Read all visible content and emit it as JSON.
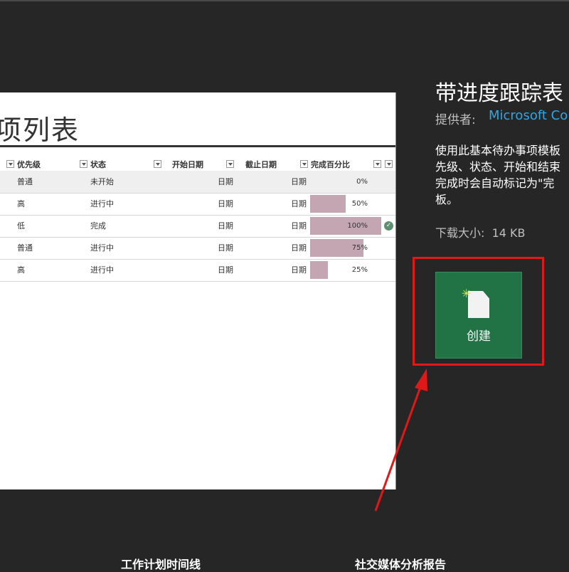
{
  "preview": {
    "title": "项列表",
    "columns": [
      "优先级",
      "状态",
      "开始日期",
      "截止日期",
      "完成百分比"
    ],
    "rows": [
      {
        "priority": "普通",
        "status": "未开始",
        "start": "日期",
        "end": "日期",
        "percent": "0%",
        "progress": 0
      },
      {
        "priority": "高",
        "status": "进行中",
        "start": "日期",
        "end": "日期",
        "percent": "50%",
        "progress": 50
      },
      {
        "priority": "低",
        "status": "完成",
        "start": "日期",
        "end": "日期",
        "percent": "100%",
        "progress": 100,
        "check_icon": "check-circle-icon",
        "check_color": "#5f8f73"
      },
      {
        "priority": "普通",
        "status": "进行中",
        "start": "日期",
        "end": "日期",
        "percent": "75%",
        "progress": 75
      },
      {
        "priority": "高",
        "status": "进行中",
        "start": "日期",
        "end": "日期",
        "percent": "25%",
        "progress": 25
      }
    ],
    "bar_color": "#c4a6b3"
  },
  "template": {
    "title": "带进度跟踪表",
    "provider_label": "提供者:",
    "provider_name": "Microsoft Co",
    "description_lines": [
      "使用此基本待办事项模板",
      "先级、状态、开始和结束",
      "完成时会自动标记为\"完",
      "板。"
    ],
    "download_size_label": "下载大小:",
    "download_size_value": "14 KB"
  },
  "create_button": {
    "label": "创建",
    "icon": "new-document-icon",
    "color": "#217346",
    "highlight_color": "#e01818"
  },
  "bottom_templates": [
    "工作计划时间线",
    "社交媒体分析报告"
  ]
}
